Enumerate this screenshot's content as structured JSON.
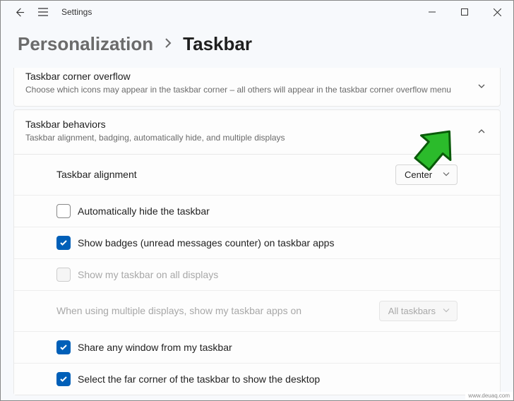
{
  "titlebar": {
    "title": "Settings"
  },
  "breadcrumb": {
    "parent": "Personalization",
    "current": "Taskbar"
  },
  "overflow_panel": {
    "title": "Taskbar corner overflow",
    "subtitle": "Choose which icons may appear in the taskbar corner – all others will appear in the taskbar corner overflow menu"
  },
  "behaviors_panel": {
    "title": "Taskbar behaviors",
    "subtitle": "Taskbar alignment, badging, automatically hide, and multiple displays",
    "alignment": {
      "label": "Taskbar alignment",
      "value": "Center"
    },
    "autohide": {
      "label": "Automatically hide the taskbar"
    },
    "badges": {
      "label": "Show badges (unread messages counter) on taskbar apps"
    },
    "all_displays": {
      "label": "Show my taskbar on all displays"
    },
    "multi": {
      "label": "When using multiple displays, show my taskbar apps on",
      "value": "All taskbars"
    },
    "share": {
      "label": "Share any window from my taskbar"
    },
    "far_corner": {
      "label": "Select the far corner of the taskbar to show the desktop"
    }
  },
  "watermark": "www.deuaq.com"
}
